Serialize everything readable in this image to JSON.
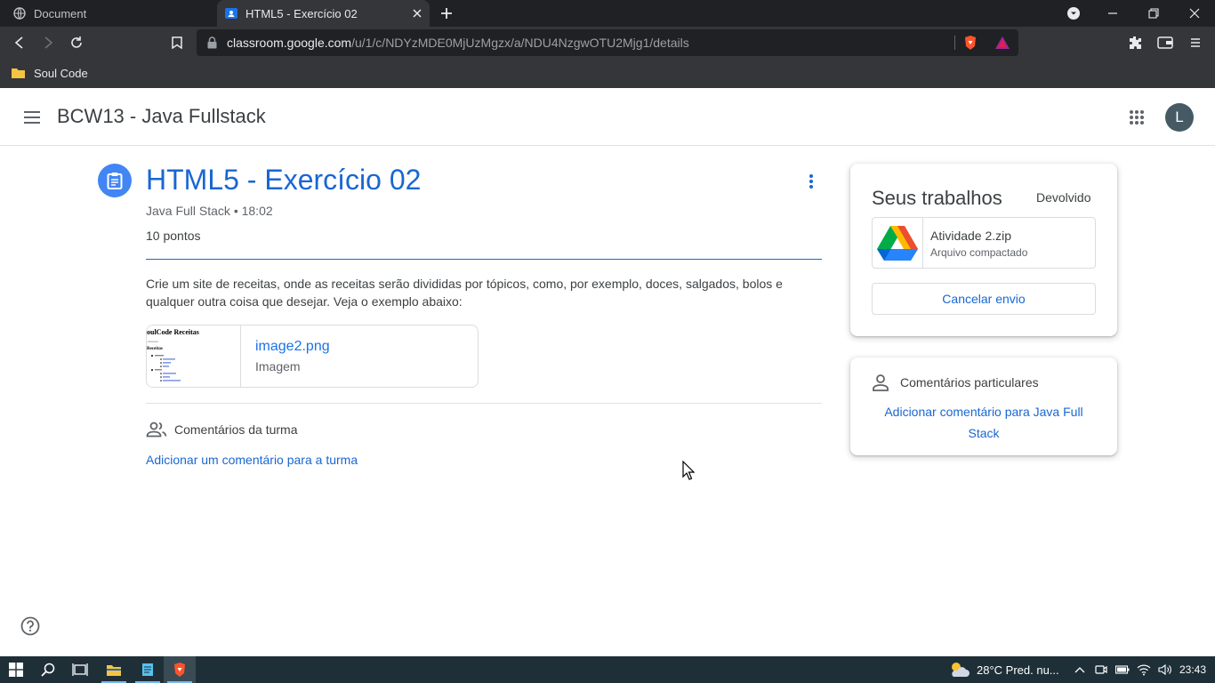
{
  "browser": {
    "tabs": [
      {
        "title": "Document",
        "active": false
      },
      {
        "title": "HTML5 - Exercício 02",
        "active": true
      }
    ],
    "url_host": "classroom.google.com",
    "url_path": "/u/1/c/NDYzMDE0MjUzMgzx/a/NDU4NzgwOTU2Mjg1/details",
    "bookmarks": [
      {
        "label": "Soul Code"
      }
    ],
    "accent_color": "#35363a"
  },
  "header": {
    "class_title": "BCW13 - Java Fullstack",
    "avatar_letter": "L"
  },
  "assignment": {
    "title": "HTML5 - Exercício 02",
    "meta": "Java Full Stack • 18:02",
    "points": "10 pontos",
    "description": "Crie um site de receitas, onde as receitas serão divididas por tópicos, como, por exemplo, doces, salgados, bolos e qualquer outra coisa que desejar. Veja o exemplo abaixo:",
    "attachment": {
      "filename": "image2.png",
      "type": "Imagem",
      "thumb_title": "oulCode Receitas",
      "thumb_subtitle": "Receitas"
    },
    "class_comments_label": "Comentários da turma",
    "add_class_comment": "Adicionar um comentário para a turma"
  },
  "work_card": {
    "title": "Seus trabalhos",
    "status": "Devolvido",
    "file_name": "Atividade 2.zip",
    "file_type": "Arquivo compactado",
    "cancel_label": "Cancelar envio"
  },
  "private_card": {
    "title": "Comentários particulares",
    "add_label": "Adicionar comentário para Java Full Stack"
  },
  "taskbar": {
    "weather": "28°C  Pred. nu...",
    "time": "23:43"
  },
  "colors": {
    "primary_blue": "#1967d2",
    "assignment_icon": "#4285f4",
    "taskbar": "#1f2f38"
  }
}
